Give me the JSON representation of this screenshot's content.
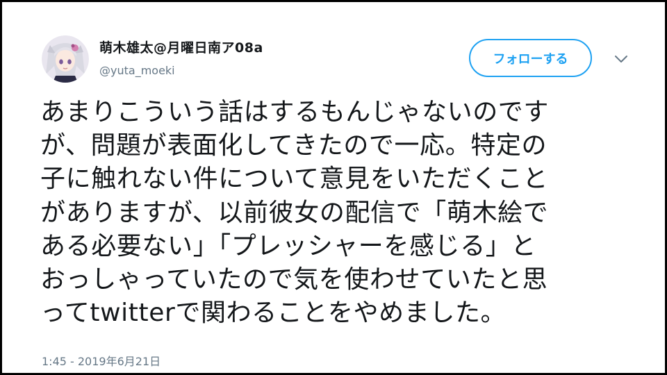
{
  "tweet": {
    "display_name": "萌木雄太@月曜日南ア08a",
    "handle": "@yuta_moeki",
    "follow_label": "フォローする",
    "lines": [
      "あまりこういう話はするもんじゃないのです",
      "が、問題が表面化してきたので一応。特定の",
      "子に触れない件について意見をいただくこと",
      "がありますが、以前彼女の配信で「萌木絵で",
      "ある必要ない」「プレッシャーを感じる」と",
      "おっしゃっていたので気を使わせていたと思",
      "ってtwitterで関わることをやめました。"
    ],
    "timestamp": "1:45 - 2019年6月21日"
  },
  "icons": {
    "avatar": "avatar-anime-girl",
    "menu": "chevron-down-icon"
  },
  "colors": {
    "accent": "#1da1f2",
    "text": "#14171a",
    "muted": "#657786",
    "frame": "#000000"
  }
}
